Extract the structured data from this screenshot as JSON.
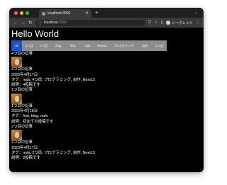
{
  "browser": {
    "tab_title": "localhost:3000",
    "url_host": "localhost",
    "url_port": ":3000",
    "profile_label": "シークレット",
    "traffic_lights": [
      "#ff5f57",
      "#febc2e",
      "#28c840"
    ]
  },
  "page": {
    "title": "Hello World",
    "nav": [
      "all",
      "3つ目",
      "4つ目",
      "blog",
      "first",
      "mdx",
      "Next13",
      "プログラミング",
      "自作",
      "2つ目"
    ],
    "posts": [
      {
        "header": "4つ目の記事",
        "title": "4つ目の記事",
        "date": "2023年4月17日",
        "tags": "タグ：mdx, 4つ目, プログラミング, 自作, Next13",
        "desc": "説明：4投稿です"
      },
      {
        "header": "1つ目の記事",
        "title": "1つ目の記事",
        "date": "2023年4月16日",
        "tags": "タグ：first, blog, mdx",
        "desc": "説明：初めての投稿です"
      },
      {
        "header": "2つ目の記事",
        "title": "2つ目の記事",
        "date": "2023年4月17日",
        "tags": "タグ：mdx, 2つ目, プログラミング, 自作, Next13",
        "desc": "説明：2投稿です"
      }
    ]
  }
}
